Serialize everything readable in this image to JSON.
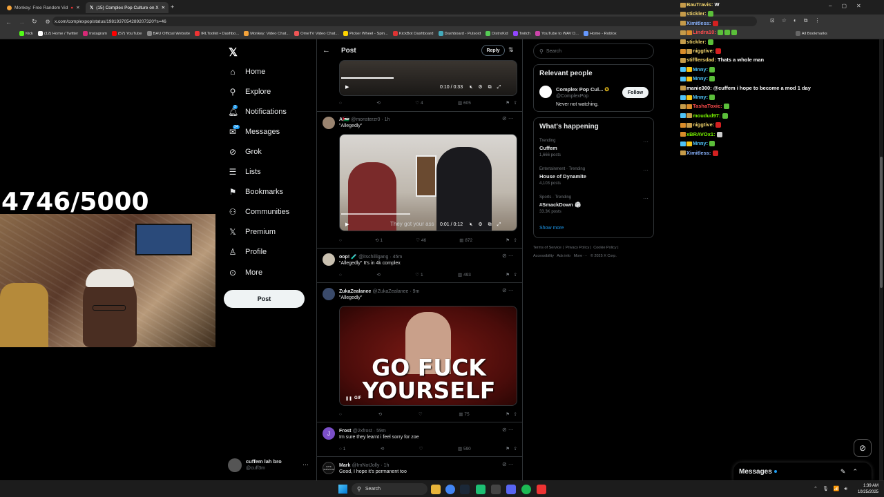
{
  "tabs": [
    {
      "label": "Monkey: Free Random Vid"
    },
    {
      "label": "(15) Complex Pop Culture on X"
    }
  ],
  "url": "x.com/complexpop/status/1981937054289207320?s=46",
  "bookmarks": [
    "Kick",
    "(12) Home / Twitter",
    "Instagram",
    "(57) YouTube",
    "BAU Official Website",
    "IRLToolkit • Dashbo...",
    "Monkey: Video Chat...",
    "OmeTV Video Chat...",
    "Picker Wheel - Spin...",
    "KickBot Dashboard",
    "Dashboard - Pulsoid",
    "DistroKid",
    "Twitch",
    "YouTube to WAV D...",
    "Home - Roblox",
    "All Bookmarks"
  ],
  "counter": "4746/5000",
  "nav": {
    "home": "Home",
    "explore": "Explore",
    "notifications": "Notifications",
    "notif_badge": "3",
    "messages": "Messages",
    "msg_badge": "34",
    "grok": "Grok",
    "lists": "Lists",
    "bookmarks": "Bookmarks",
    "communities": "Communities",
    "premium": "Premium",
    "profile": "Profile",
    "more": "More",
    "post": "Post"
  },
  "account": {
    "name": "cuffem lah bro",
    "handle": "@cuff3m"
  },
  "header": {
    "title": "Post",
    "reply": "Reply"
  },
  "tweets": [
    {
      "time_video": "0:10 / 0:33",
      "likes": "4",
      "views": "605"
    },
    {
      "name": "A​",
      "handle": "@monsterzr0 · 1h",
      "text": "\"Allegedly\"",
      "caption": "They got your ass",
      "time_video": "0:01 / 0:12",
      "retweets": "1",
      "likes": "46",
      "views": "872"
    },
    {
      "name": "oop! 🧪",
      "handle": "@itschilligang · 45m",
      "text": "\"Allegedly\" It's in 4k complex",
      "likes": "1",
      "views": "493"
    },
    {
      "name": "ZukaZealanee",
      "handle": "@ZukaZealanee · 9m",
      "text": "\"Allegedly\"",
      "gif_line1": "GO FUCK",
      "gif_line2": "YOURSELF",
      "gif": "GIF",
      "views": "75"
    },
    {
      "name": "Frost",
      "handle": "@2xfrost · 59m",
      "text": "Im sure they learnt i feel sorry for zoe",
      "replies": "1",
      "views": "590",
      "avatar_letter": "J"
    },
    {
      "name": "Mark",
      "handle": "@ImNotJolly · 1h",
      "text": "Good, I hope it's permanent too",
      "avatar_text": "HATE SURVIVOR"
    }
  ],
  "search": {
    "placeholder": "Search"
  },
  "relevant": {
    "title": "Relevant people",
    "name": "Complex Pop Cul...",
    "handle": "@ComplexPop",
    "bio": "Never not watching.",
    "follow": "Follow"
  },
  "happening": {
    "title": "What's happening",
    "items": [
      {
        "meta": "Trending",
        "topic": "Cuffem",
        "posts": "1,666 posts"
      },
      {
        "meta": "Entertainment · Trending",
        "topic": "House of Dynamite",
        "posts": "4,103 posts"
      },
      {
        "meta": "Sports · Trending",
        "topic": "#SmackDown 🏟",
        "posts": "33.3K posts"
      }
    ],
    "show_more": "Show more"
  },
  "footer": [
    "Terms of Service",
    "|",
    "Privacy Policy",
    "|",
    "Cookie Policy",
    "|",
    "Accessibility",
    "Ads info",
    "More ···",
    "© 2025 X Corp."
  ],
  "chat": [
    {
      "user": "BauTravis:",
      "msg": "W",
      "color": "#f5d76e"
    },
    {
      "user": "stickler:",
      "msg": "",
      "color": "#f5d76e",
      "emote": "#5bbf3a"
    },
    {
      "user": "Ximitless:",
      "msg": "",
      "color": "#8ab4ff",
      "emote": "#d32020"
    },
    {
      "user": "Lindra10:",
      "msg": "",
      "color": "#ff4d4d",
      "emote": "#5bbf3a"
    },
    {
      "user": "stickler:",
      "msg": "",
      "color": "#f5d76e",
      "emote": "#5bbf3a"
    },
    {
      "user": "niggtive:",
      "msg": "",
      "color": "#f5d76e",
      "emote": "#d32020"
    },
    {
      "user": "stifflersdad:",
      "msg": "Thats a whole man",
      "color": "#f5d76e"
    },
    {
      "user": "Mnny:",
      "msg": "",
      "color": "#4fc3f7",
      "emote": "#5bbf3a"
    },
    {
      "user": "Mnny:",
      "msg": "",
      "color": "#4fc3f7",
      "emote": "#5bbf3a"
    },
    {
      "user": "manie300:",
      "msg": "@cuffem i hope to become a mod 1 day",
      "color": "#ffffff"
    },
    {
      "user": "Mnny:",
      "msg": "",
      "color": "#4fc3f7",
      "emote": "#5bbf3a"
    },
    {
      "user": "TashaToxic:",
      "msg": "",
      "color": "#ff4d4d",
      "emote": "#5bbf3a"
    },
    {
      "user": "moudud97:",
      "msg": "",
      "color": "#7cfc00",
      "emote": "#5bbf3a"
    },
    {
      "user": "niggtive:",
      "msg": "",
      "color": "#f5d76e",
      "emote": "#d32020"
    },
    {
      "user": "xBRAVOx1:",
      "msg": "",
      "color": "#7cfc00",
      "emote": "#cccccc"
    },
    {
      "user": "Mnny:",
      "msg": "",
      "color": "#4fc3f7",
      "emote": "#5bbf3a"
    },
    {
      "user": "Ximitless:",
      "msg": "",
      "color": "#8ab4ff",
      "emote": "#d32020"
    }
  ],
  "dm": {
    "label": "Messages"
  },
  "taskbar": {
    "search": "Search",
    "time": "1:39 AM",
    "date": "10/25/2025"
  }
}
